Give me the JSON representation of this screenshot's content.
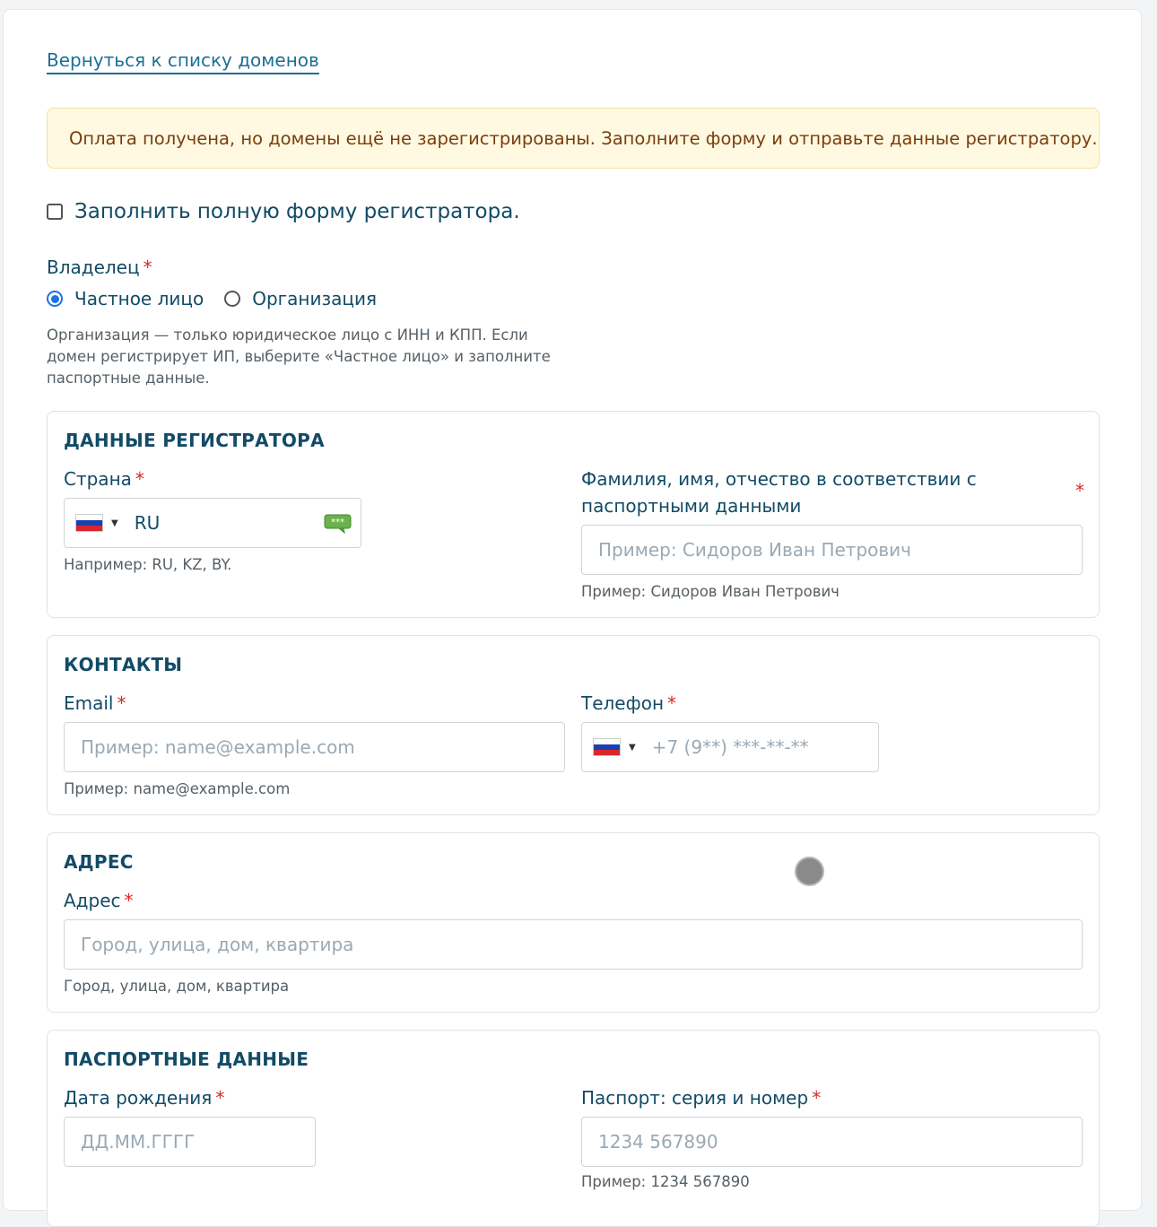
{
  "back_link": "Вернуться к списку доменов",
  "alert": "Оплата получена, но домены ещё не зарегистрированы. Заполните форму и отправьте данные регистратору.",
  "full_form_checkbox": {
    "label": "Заполнить полную форму регистратора.",
    "checked": false
  },
  "owner": {
    "label": "Владелец",
    "required_mark": "*",
    "options": [
      {
        "label": "Частное лицо",
        "selected": true
      },
      {
        "label": "Организация",
        "selected": false
      }
    ],
    "help": "Организация — только юридическое лицо с ИНН и КПП. Если домен регистрирует ИП, выберите «Частное лицо» и заполните паспортные данные."
  },
  "sections": {
    "registrar": {
      "title": "ДАННЫЕ РЕГИСТРАТОРА",
      "country": {
        "label": "Страна",
        "value": "RU",
        "help": "Например: RU, KZ, BY.",
        "flag_icon": "russia-flag-icon",
        "action_icon": "password-chat-icon"
      },
      "fio": {
        "label_line1": "Фамилия, имя, отчество в соответствии с",
        "label_line2": "паспортными данными",
        "placeholder": "Пример: Сидоров Иван Петрович",
        "help": "Пример: Сидоров Иван Петрович"
      }
    },
    "contacts": {
      "title": "КОНТАКТЫ",
      "email": {
        "label": "Email",
        "placeholder": "Пример: name@example.com",
        "help": "Пример: name@example.com"
      },
      "phone": {
        "label": "Телефон",
        "placeholder": "+7 (9**) ***-**-**",
        "flag_icon": "russia-flag-icon"
      }
    },
    "address": {
      "title": "АДРЕС",
      "address": {
        "label": "Адрес",
        "placeholder": "Город, улица, дом, квартира",
        "help": "Город, улица, дом, квартира"
      }
    },
    "passport": {
      "title": "ПАСПОРТНЫЕ ДАННЫЕ",
      "birth": {
        "label": "Дата рождения",
        "placeholder": "ДД.ММ.ГГГГ"
      },
      "number": {
        "label": "Паспорт: серия и номер",
        "placeholder": "1234 567890",
        "help": "Пример: 1234 567890"
      }
    }
  },
  "required_mark": "*",
  "colors": {
    "accent": "#124b66",
    "link": "#1d6f95",
    "required": "#d62828",
    "alert_bg": "#fff9e1",
    "alert_text": "#7a3d0c",
    "radio_selected": "#1a73e8"
  }
}
